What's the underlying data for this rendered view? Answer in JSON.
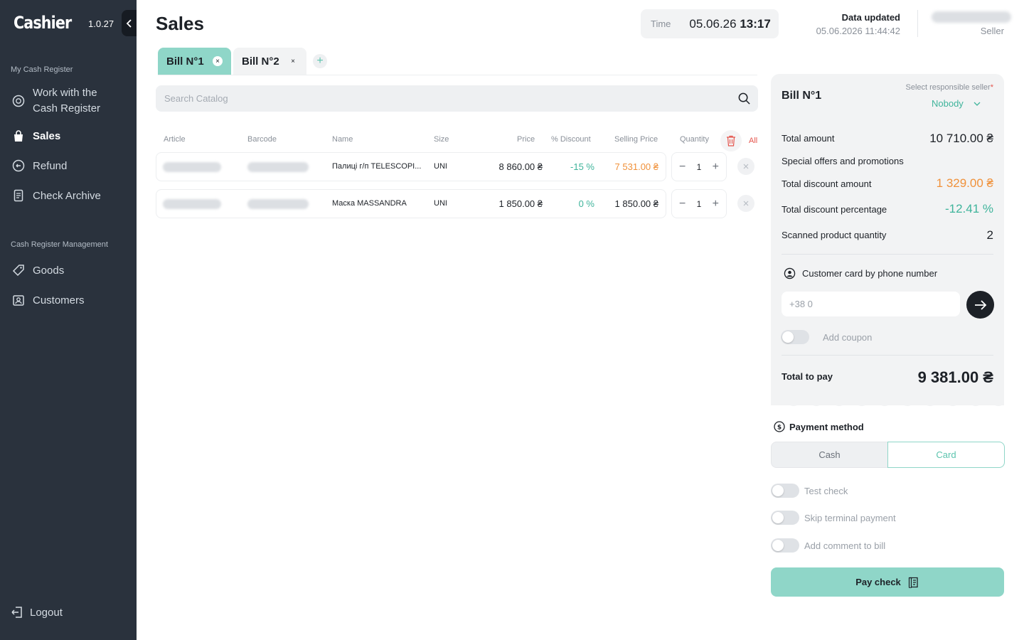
{
  "sidebar": {
    "brand": "Cashier",
    "version": "1.0.27",
    "section_register": "My Cash Register",
    "section_management": "Cash Register Management",
    "items": [
      {
        "label_line1": "Work with the",
        "label_line2": "Cash Register",
        "icon": "coin-icon"
      },
      {
        "label": "Sales",
        "icon": "shopping-bag-icon"
      },
      {
        "label": "Refund",
        "icon": "refund-icon"
      },
      {
        "label": "Check Archive",
        "icon": "archive-icon"
      },
      {
        "label": "Goods",
        "icon": "tag-icon"
      },
      {
        "label": "Customers",
        "icon": "customers-icon"
      }
    ],
    "logout": "Logout"
  },
  "header": {
    "title": "Sales",
    "time_label": "Time",
    "time_date": "05.06.26",
    "time_clock": "13:17",
    "updated_label": "Data updated",
    "updated_value": "05.06.2026 11:44:42",
    "seller_label": "Seller"
  },
  "tabs": [
    {
      "label": "Bill N°1",
      "close": "×"
    },
    {
      "label": "Bill N°2",
      "close": "×"
    }
  ],
  "tab_add": "+",
  "search": {
    "placeholder": "Search Catalog"
  },
  "table": {
    "headers": {
      "article": "Article",
      "barcode": "Barcode",
      "name": "Name",
      "size": "Size",
      "price": "Price",
      "discount": "% Discount",
      "selling": "Selling Price",
      "quantity": "Quantity",
      "all": "All"
    },
    "rows": [
      {
        "name": "Палиці г/п TELESCOPI...",
        "size": "UNI",
        "price": "8 860.00 ₴",
        "discount": "-15 %",
        "selling": "7 531.00 ₴",
        "qty": "1"
      },
      {
        "name": "Маска MASSANDRA",
        "size": "UNI",
        "price": "1 850.00 ₴",
        "discount": "0 %",
        "selling": "1 850.00 ₴",
        "qty": "1"
      }
    ]
  },
  "bill": {
    "title": "Bill N°1",
    "seller_select_label": "Select responsible seller",
    "seller_required": "*",
    "seller_value": "Nobody",
    "total_amount_label": "Total amount",
    "total_amount": "10 710.00 ₴",
    "special_offers": "Special offers and promotions",
    "discount_amount_label": "Total discount amount",
    "discount_amount": "1 329.00 ₴",
    "discount_percent_label": "Total discount percentage",
    "discount_percent": "-12.41 %",
    "scanned_label": "Scanned product quantity",
    "scanned": "2",
    "customer_card_label": "Customer card by phone number",
    "phone_placeholder": "+38 0",
    "coupon_label": "Add coupon",
    "total_pay_label": "Total to pay",
    "total_pay": "9 381.00 ₴"
  },
  "payment": {
    "title": "Payment method",
    "cash": "Cash",
    "card": "Card",
    "test_check": "Test check",
    "skip_terminal": "Skip terminal payment",
    "add_comment": "Add comment to bill",
    "pay_button": "Pay check"
  },
  "colors": {
    "sidebar": "#2a323d",
    "accent": "#8fd6c8",
    "accent_text": "#3fb49b",
    "orange": "#f0913a",
    "red": "#e5534b"
  }
}
